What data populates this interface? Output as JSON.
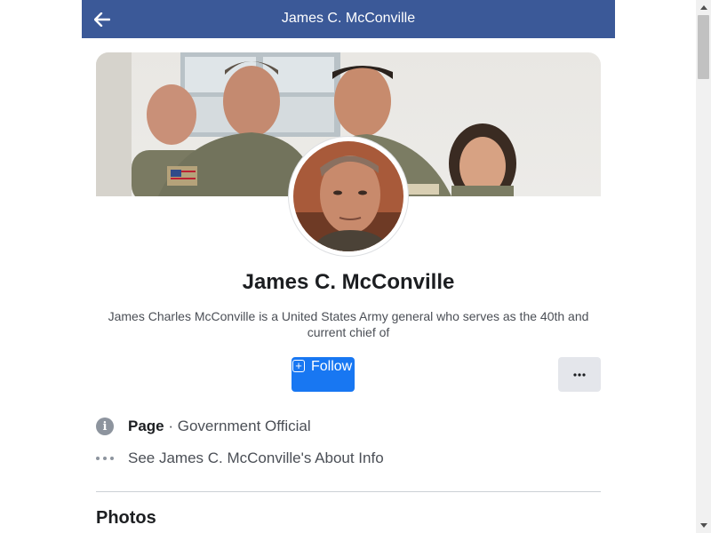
{
  "header": {
    "title": "James C. McConville",
    "back_icon": "arrow-left-icon",
    "bg_color": "#3b5998"
  },
  "profile": {
    "name": "James C. McConville",
    "bio": "James Charles McConville is a United States Army general who serves as the 40th and current chief of",
    "cover_description": "cover-photo",
    "avatar_description": "profile-photo"
  },
  "actions": {
    "follow_label": "Follow",
    "follow_icon": "plus-square-icon",
    "more_label": "···",
    "accent_color": "#1877f2"
  },
  "info": {
    "category_prefix": "Page",
    "category_sep": " · ",
    "category_value": "Government Official",
    "about_link": "See James C. McConville's About Info"
  },
  "sections": {
    "photos_title": "Photos"
  }
}
